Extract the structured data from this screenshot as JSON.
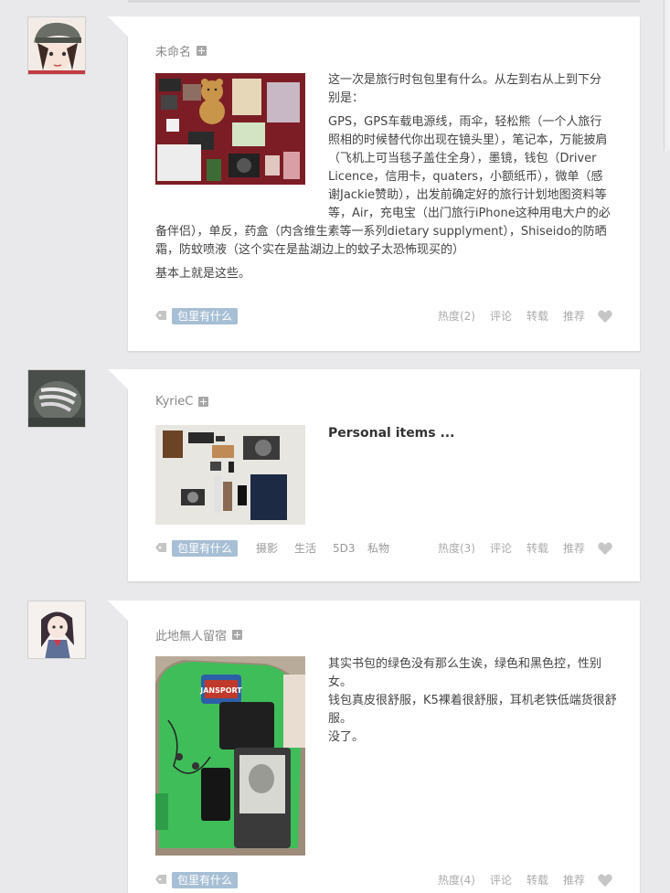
{
  "posts": [
    {
      "author": "未命名",
      "paragraphs": [
        "这一次是旅行时包包里有什么。从左到右从上到下分别是：",
        "GPS，GPS车载电源线，雨伞，轻松熊（一个人旅行照相的时候替代你出现在镜头里），笔记本，万能披肩（飞机上可当毯子盖住全身），墨镜，钱包（Driver Licence，信用卡，quaters，小额纸币），微单（感谢Jackie赞助），出发前确定好的旅行计划地图资料等等，Air，充电宝（出门旅行iPhone这种用电大户的必备伴侣），单反，药盒（内含维生素等一系列dietary supplyment），Shiseido的防晒霜，防蚊喷液（这个实在是盐湖边上的蚊子太恐怖现买的）",
        "基本上就是这些。"
      ],
      "tag": "包里有什么",
      "extra_tags": [],
      "hot": "热度(2)",
      "comment": "评论",
      "reblog": "转载",
      "recommend": "推荐"
    },
    {
      "author": "KyrieC",
      "title": "Personal items ...",
      "tag": "包里有什么",
      "extra_tags": [
        "摄影",
        "生活",
        "5D3",
        "私物"
      ],
      "hot": "热度(3)",
      "comment": "评论",
      "reblog": "转载",
      "recommend": "推荐"
    },
    {
      "author": "此地無人留宿",
      "lines": [
        "其实书包的绿色没有那么生诶，绿色和黑色控，性别女。",
        "钱包真皮很舒服，K5裸着很舒服，耳机老铁低端货很舒服。",
        "没了。"
      ],
      "photo_brand": "JANSPORT",
      "tag": "包里有什么",
      "hot": "热度(4)",
      "comment": "评论",
      "reblog": "转载",
      "recommend": "推荐"
    }
  ],
  "colors": {
    "tag_bg": "#a7bfd4",
    "page_bg": "#e9e9eb",
    "card_bg": "#ffffff"
  }
}
